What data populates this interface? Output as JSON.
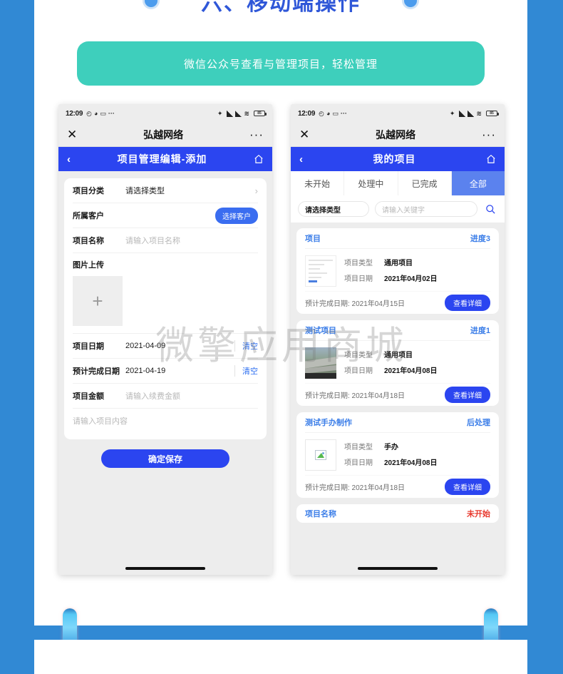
{
  "section": {
    "title": "六、移动端操作",
    "banner_text": "微信公众号查看与管理项目，轻松管理",
    "accent_blue": "#2f57d8",
    "banner_color": "#3ecfbc",
    "frame_blue": "#3189d4"
  },
  "watermark": "微擎应用商城",
  "phone_left": {
    "statusbar": {
      "time": "12:09",
      "icons": [
        "alarm-icon",
        "mute-icon",
        "message-icon",
        "more-icon"
      ],
      "right_icons": [
        "bluetooth-icon",
        "signal-icon",
        "signal-icon",
        "wifi-icon",
        "battery-icon"
      ],
      "battery_level": "85"
    },
    "wechat_bar": {
      "close": "✕",
      "title": "弘越网络",
      "more": "···"
    },
    "navbar": {
      "back": "‹",
      "title": "项目管理编辑-添加",
      "home": "home-icon"
    },
    "form": {
      "rows": [
        {
          "label": "项目分类",
          "placeholder": "请选择类型",
          "type": "select"
        },
        {
          "label": "所属客户",
          "button": "选择客户",
          "type": "button"
        },
        {
          "label": "项目名称",
          "placeholder": "请输入项目名称",
          "type": "input"
        }
      ],
      "upload_label": "图片上传",
      "upload_plus": "+",
      "date_rows": [
        {
          "label": "项目日期",
          "value": "2021-04-09",
          "clear": "清空"
        },
        {
          "label": "预计完成日期",
          "value": "2021-04-19",
          "clear": "清空"
        },
        {
          "label": "项目金额",
          "placeholder": "请输入续费金额"
        }
      ],
      "memo_placeholder": "请输入项目内容",
      "save_label": "确定保存"
    }
  },
  "phone_right": {
    "statusbar": {
      "time": "12:09",
      "icons": [
        "alarm-icon",
        "mute-icon",
        "message-icon",
        "more-icon"
      ],
      "right_icons": [
        "bluetooth-icon",
        "signal-icon",
        "signal-icon",
        "wifi-icon",
        "battery-icon"
      ],
      "battery_level": "85"
    },
    "wechat_bar": {
      "close": "✕",
      "title": "弘越网络",
      "more": "···"
    },
    "navbar": {
      "back": "‹",
      "title": "我的项目",
      "home": "home-icon"
    },
    "tabs": [
      {
        "label": "未开始",
        "active": false
      },
      {
        "label": "处理中",
        "active": false
      },
      {
        "label": "已完成",
        "active": false
      },
      {
        "label": "全部",
        "active": true
      }
    ],
    "filter": {
      "type_value": "请选择类型",
      "keyword_placeholder": "请输入关键字",
      "search_icon": "search-icon"
    },
    "cards": [
      {
        "name": "项目",
        "status": "进度3",
        "status_red": false,
        "thumb": "doc",
        "type_key": "项目类型",
        "type_value": "通用项目",
        "date_key": "项目日期",
        "date_value": "2021年04月02日",
        "eta": "预计完成日期: 2021年04月15日",
        "detail_label": "查看详细"
      },
      {
        "name": "测试项目",
        "status": "进度1",
        "status_red": false,
        "thumb": "photo",
        "type_key": "项目类型",
        "type_value": "通用项目",
        "date_key": "项目日期",
        "date_value": "2021年04月08日",
        "eta": "预计完成日期: 2021年04月18日",
        "detail_label": "查看详细"
      },
      {
        "name": "测试手办制作",
        "status": "后处理",
        "status_red": false,
        "thumb": "broken",
        "type_key": "项目类型",
        "type_value": "手办",
        "date_key": "项目日期",
        "date_value": "2021年04月08日",
        "eta": "预计完成日期: 2021年04月18日",
        "detail_label": "查看详细"
      }
    ],
    "partial_card": {
      "name": "项目名称",
      "status": "未开始",
      "status_red": true
    }
  }
}
